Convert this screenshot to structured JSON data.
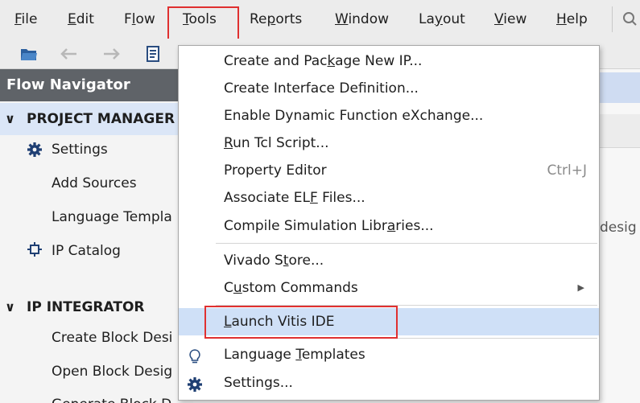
{
  "menubar": {
    "items": [
      {
        "pre": "",
        "u": "F",
        "post": "ile"
      },
      {
        "pre": "",
        "u": "E",
        "post": "dit"
      },
      {
        "pre": "F",
        "u": "l",
        "post": "ow"
      },
      {
        "pre": "",
        "u": "T",
        "post": "ools"
      },
      {
        "pre": "Re",
        "u": "p",
        "post": "orts"
      },
      {
        "pre": "",
        "u": "W",
        "post": "indow"
      },
      {
        "pre": "La",
        "u": "y",
        "post": "out"
      },
      {
        "pre": "",
        "u": "V",
        "post": "iew"
      },
      {
        "pre": "",
        "u": "H",
        "post": "elp"
      }
    ]
  },
  "flow_navigator": {
    "title": "Flow Navigator",
    "project_manager": {
      "label": "PROJECT MANAGER",
      "items": [
        "Settings",
        "Add Sources",
        "Language Templates",
        "IP Catalog"
      ]
    },
    "ip_integrator": {
      "label": "IP INTEGRATOR",
      "items": [
        "Create Block Design",
        "Open Block Design",
        "Generate Block Design"
      ]
    }
  },
  "right_pane": {
    "partial_text": "desig"
  },
  "tools_menu": {
    "items": [
      {
        "pre": "Create and Pac",
        "u": "k",
        "post": "age New IP...",
        "shortcut": ""
      },
      {
        "pre": "Create Interface Definition...",
        "u": "",
        "post": "",
        "shortcut": ""
      },
      {
        "pre": "Enable Dynamic Function eXchange...",
        "u": "",
        "post": "",
        "shortcut": ""
      },
      {
        "pre": "",
        "u": "R",
        "post": "un Tcl Script...",
        "shortcut": ""
      },
      {
        "pre": "Property Editor",
        "u": "",
        "post": "",
        "shortcut": "Ctrl+J"
      },
      {
        "pre": "Associate EL",
        "u": "F",
        "post": " Files...",
        "shortcut": ""
      },
      {
        "pre": "Compile Simulation Libr",
        "u": "a",
        "post": "ries...",
        "shortcut": ""
      },
      {
        "pre": "Vivado S",
        "u": "t",
        "post": "ore...",
        "shortcut": ""
      },
      {
        "pre": "C",
        "u": "u",
        "post": "stom Commands",
        "shortcut": ""
      },
      {
        "pre": "",
        "u": "L",
        "post": "aunch Vitis IDE",
        "shortcut": ""
      },
      {
        "pre": "Language ",
        "u": "T",
        "post": "emplates",
        "shortcut": ""
      },
      {
        "pre": "Settings...",
        "u": "",
        "post": "",
        "shortcut": ""
      }
    ]
  },
  "colors": {
    "highlight_box": "#e03030",
    "hover_row": "#cfe0f7",
    "nav_header": "#5f6368"
  }
}
